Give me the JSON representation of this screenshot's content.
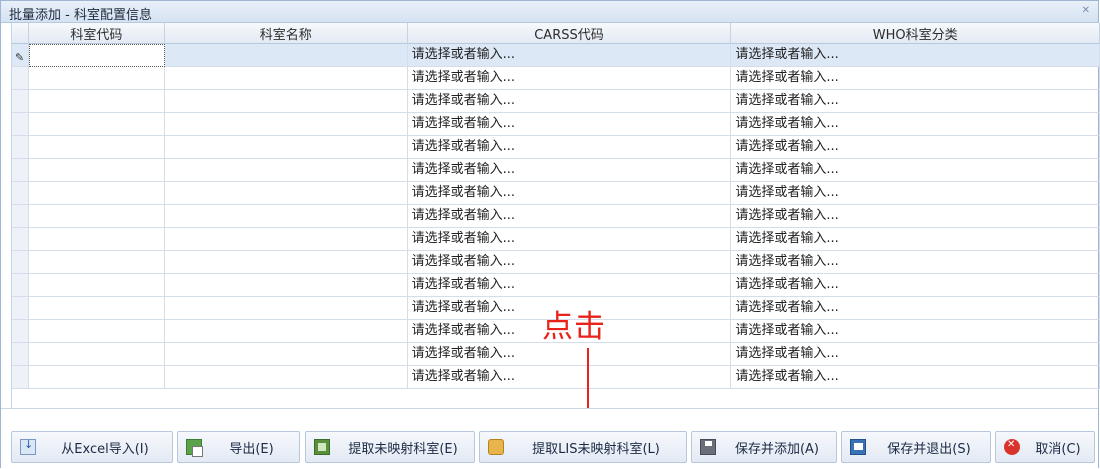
{
  "window": {
    "title": "批量添加 - 科室配置信息",
    "close_icon": "close-x-icon"
  },
  "grid": {
    "columns": [
      "科室代码",
      "科室名称",
      "CARSS代码",
      "WHO科室分类"
    ],
    "rows": [
      {
        "code": "",
        "name": "",
        "carss": "请选择或者输入...",
        "who": "请选择或者输入..."
      },
      {
        "code": "",
        "name": "",
        "carss": "请选择或者输入...",
        "who": "请选择或者输入..."
      },
      {
        "code": "",
        "name": "",
        "carss": "请选择或者输入...",
        "who": "请选择或者输入..."
      },
      {
        "code": "",
        "name": "",
        "carss": "请选择或者输入...",
        "who": "请选择或者输入..."
      },
      {
        "code": "",
        "name": "",
        "carss": "请选择或者输入...",
        "who": "请选择或者输入..."
      },
      {
        "code": "",
        "name": "",
        "carss": "请选择或者输入...",
        "who": "请选择或者输入..."
      },
      {
        "code": "",
        "name": "",
        "carss": "请选择或者输入...",
        "who": "请选择或者输入..."
      },
      {
        "code": "",
        "name": "",
        "carss": "请选择或者输入...",
        "who": "请选择或者输入..."
      },
      {
        "code": "",
        "name": "",
        "carss": "请选择或者输入...",
        "who": "请选择或者输入..."
      },
      {
        "code": "",
        "name": "",
        "carss": "请选择或者输入...",
        "who": "请选择或者输入..."
      },
      {
        "code": "",
        "name": "",
        "carss": "请选择或者输入...",
        "who": "请选择或者输入..."
      },
      {
        "code": "",
        "name": "",
        "carss": "请选择或者输入...",
        "who": "请选择或者输入..."
      },
      {
        "code": "",
        "name": "",
        "carss": "请选择或者输入...",
        "who": "请选择或者输入..."
      },
      {
        "code": "",
        "name": "",
        "carss": "请选择或者输入...",
        "who": "请选择或者输入..."
      },
      {
        "code": "",
        "name": "",
        "carss": "请选择或者输入...",
        "who": "请选择或者输入..."
      }
    ],
    "selected_row": 0,
    "edit_icon": "pencil-icon"
  },
  "annotation": {
    "text": "点击",
    "color": "#e8231a"
  },
  "toolbar": {
    "buttons": [
      {
        "label": "从Excel导入(I)",
        "icon": "import-icon"
      },
      {
        "label": "导出(E)",
        "icon": "export-icon"
      },
      {
        "label": "提取未映射科室(E)",
        "icon": "grid-extract-icon"
      },
      {
        "label": "提取LIS未映射科室(L)",
        "icon": "database-extract-icon"
      },
      {
        "label": "保存并添加(A)",
        "icon": "save-icon"
      },
      {
        "label": "保存并退出(S)",
        "icon": "save-exit-icon"
      },
      {
        "label": "取消(C)",
        "icon": "cancel-icon"
      }
    ]
  }
}
